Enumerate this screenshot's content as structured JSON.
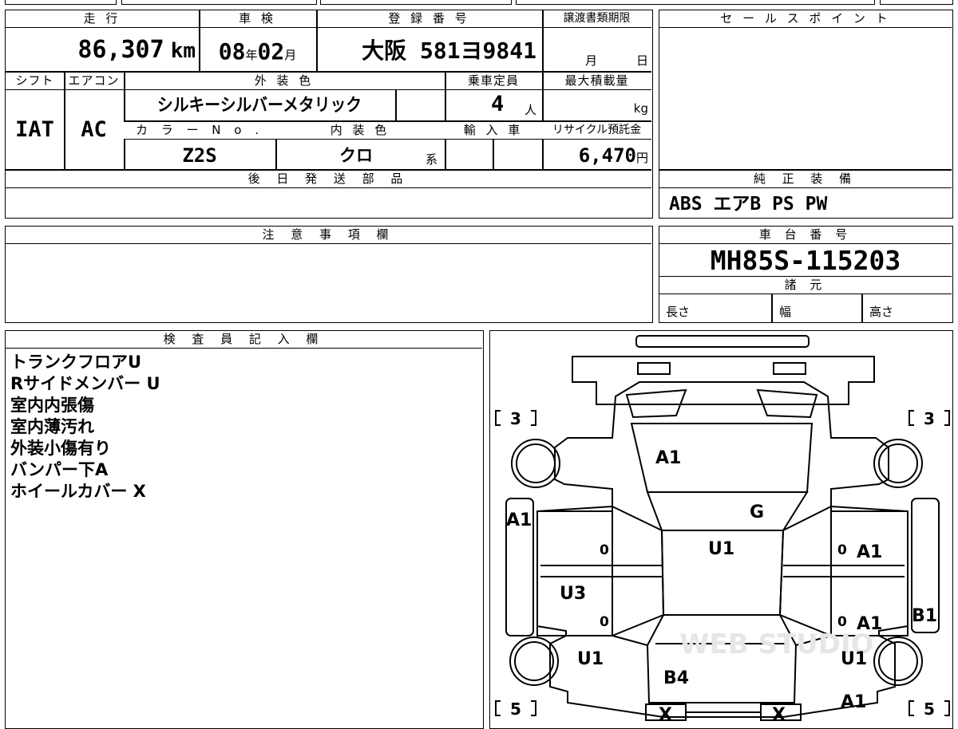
{
  "headers": {
    "mileage": "走 行",
    "inspection": "車 検",
    "registration": "登 録 番 号",
    "transfer_deadline": "譲渡書類期限",
    "sales_point": "セ ー ル ス ポ イ ン ト",
    "shift": "シフト",
    "aircon": "エアコン",
    "exterior_color": "外 装 色",
    "capacity": "乗車定員",
    "max_load": "最大積載量",
    "color_no": "カ ラ ー N o .",
    "interior_color": "内 装 色",
    "import": "輸 入 車",
    "recycle": "リサイクル預託金",
    "later_parts": "後 日 発 送 部 品",
    "genuine_equipment": "純 正 装 備",
    "caution": "注 意 事 項 欄",
    "chassis_no": "車 台 番 号",
    "specs": "諸 元",
    "inspector": "検 査 員 記 入 欄"
  },
  "values": {
    "mileage_num": "86,307",
    "mileage_unit": "km",
    "inspection_year": "08",
    "year_unit": "年",
    "inspection_month": "02",
    "month_unit": "月",
    "registration": "大阪 581ヨ9841",
    "deadline_month": "月",
    "deadline_day": "日",
    "shift": "IAT",
    "aircon": "AC",
    "exterior_color": "シルキーシルバーメタリック",
    "capacity": "4",
    "capacity_unit": "人",
    "load_unit": "kg",
    "color_no": "Z2S",
    "interior_color": "クロ",
    "interior_suffix": "系",
    "recycle": "6,470",
    "recycle_unit": "円",
    "genuine_equipment": "ABS エアB PS PW",
    "chassis_no": "MH85S-115203",
    "length": "長さ",
    "width": "幅",
    "height": "高さ"
  },
  "inspector_notes": [
    "トランクフロアU",
    "Rサイドメンバー U",
    "室内内張傷",
    "室内薄汚れ",
    "外装小傷有り",
    "バンパー下A",
    "ホイールカバー X"
  ],
  "diagram": {
    "labels": {
      "hood": "A1",
      "windshield": "G",
      "roof": "U1",
      "left_front_fender": "A1",
      "right_front_door": "A1",
      "right_rear_door": "A1",
      "left_rear_door": "U3",
      "right_rear_panel": "B1",
      "left_rear_quarter": "U1",
      "right_rear_quarter": "U1",
      "rear_gate": "B4",
      "right_rear_corner": "A1",
      "left_rear_bumper": "X",
      "right_rear_bumper": "X",
      "front_left_tire_tread": "3",
      "front_right_tire_tread": "3",
      "rear_left_tire_tread": "5",
      "rear_right_tire_tread": "5",
      "zero_marks": [
        "0",
        "0",
        "0",
        "0"
      ]
    },
    "watermark": "WEB STUDIO"
  }
}
